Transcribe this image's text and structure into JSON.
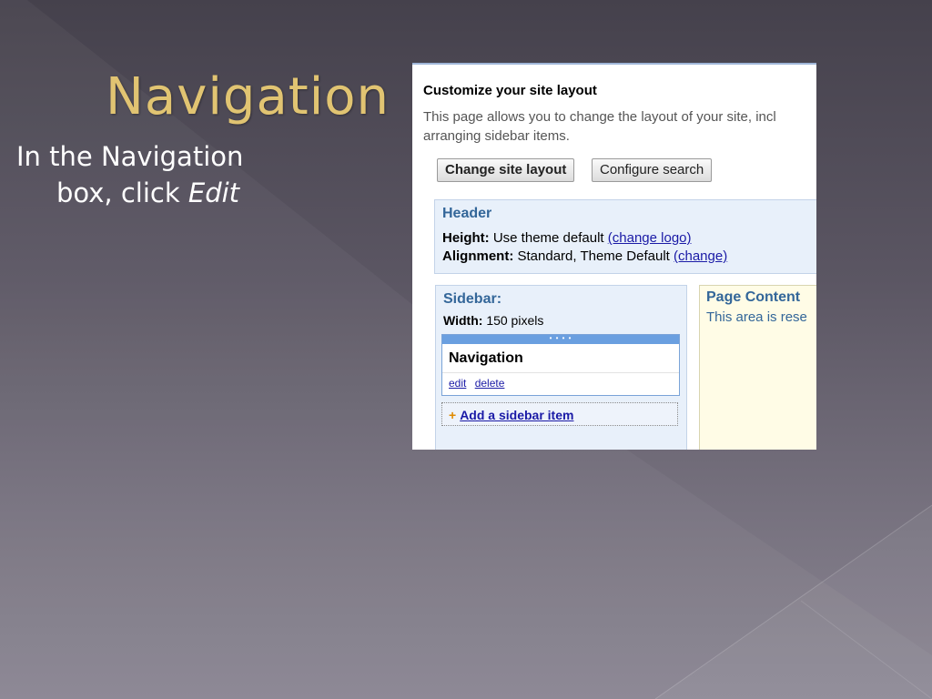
{
  "slide": {
    "title": "Navigation",
    "instruction_line1": "In the Navigation",
    "instruction_line2_prefix": "box, click ",
    "instruction_line2_emph": "Edit"
  },
  "screenshot": {
    "heading": "Customize your site layout",
    "desc_line1": "This page allows you to change the layout of your site, incl",
    "desc_line2": "arranging sidebar items.",
    "buttons": {
      "change_layout": "Change site layout",
      "configure_search": "Configure search"
    },
    "header_section": {
      "title": "Header",
      "height_label": "Height:",
      "height_value": "Use theme default",
      "height_link": "(change logo)",
      "alignment_label": "Alignment:",
      "alignment_value": "Standard, Theme Default",
      "alignment_link": "(change)"
    },
    "sidebar_section": {
      "title": "Sidebar:",
      "width_label": "Width:",
      "width_value": "150 pixels",
      "handle_glyph": "• • • •",
      "widget_title": "Navigation",
      "edit_link": "edit",
      "delete_link": "delete",
      "add_plus": "+",
      "add_item_link": "Add a sidebar item"
    },
    "page_content_section": {
      "title": "Page Content",
      "text": "This area is rese"
    }
  },
  "colors": {
    "title_gold": "#e1c472",
    "section_blue": "#336699",
    "link_blue": "#1a1aa6",
    "widget_border": "#7aa3d8"
  }
}
